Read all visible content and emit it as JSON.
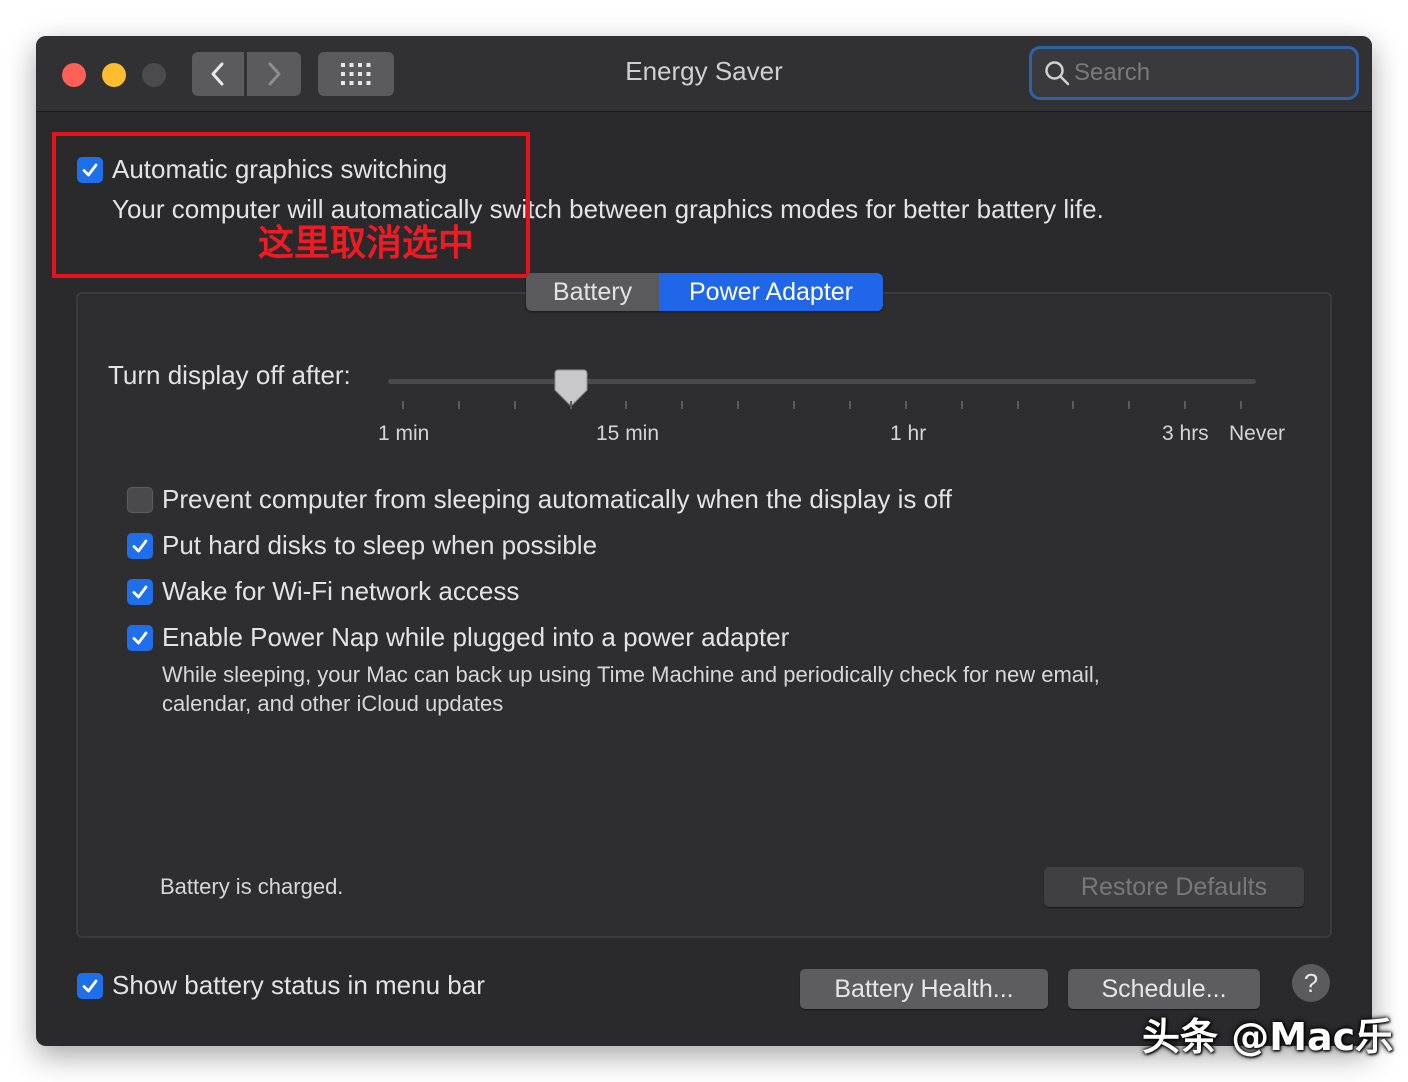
{
  "window": {
    "title": "Energy Saver",
    "search_placeholder": "Search"
  },
  "graphics_switching": {
    "label": "Automatic graphics switching",
    "checked": true,
    "description": "Your computer will automatically switch between graphics modes for better battery life."
  },
  "annotation": {
    "text": "这里取消选中",
    "color": "#e8131a"
  },
  "tabs": [
    {
      "label": "Battery",
      "selected": false
    },
    {
      "label": "Power Adapter",
      "selected": true
    }
  ],
  "display_off": {
    "label": "Turn display off after:",
    "value": "10 min",
    "tick_labels": [
      "1 min",
      "15 min",
      "1 hr",
      "3 hrs",
      "Never"
    ]
  },
  "options": [
    {
      "label": "Prevent computer from sleeping automatically when the display is off",
      "checked": false
    },
    {
      "label": "Put hard disks to sleep when possible",
      "checked": true
    },
    {
      "label": "Wake for Wi-Fi network access",
      "checked": true
    },
    {
      "label": "Enable Power Nap while plugged into a power adapter",
      "checked": true,
      "description_line1": "While sleeping, your Mac can back up using Time Machine and periodically check for new email,",
      "description_line2": "calendar, and other iCloud updates"
    }
  ],
  "status": "Battery is charged.",
  "restore_defaults": "Restore Defaults",
  "show_battery_status": {
    "label": "Show battery status in menu bar",
    "checked": true
  },
  "battery_health_button": "Battery Health...",
  "schedule_button": "Schedule...",
  "help_symbol": "?",
  "watermark": "头条 @Mac乐",
  "colors": {
    "accent": "#1f6fea",
    "window_bg": "#2a2a2c",
    "annotation_red": "#e8131a"
  }
}
